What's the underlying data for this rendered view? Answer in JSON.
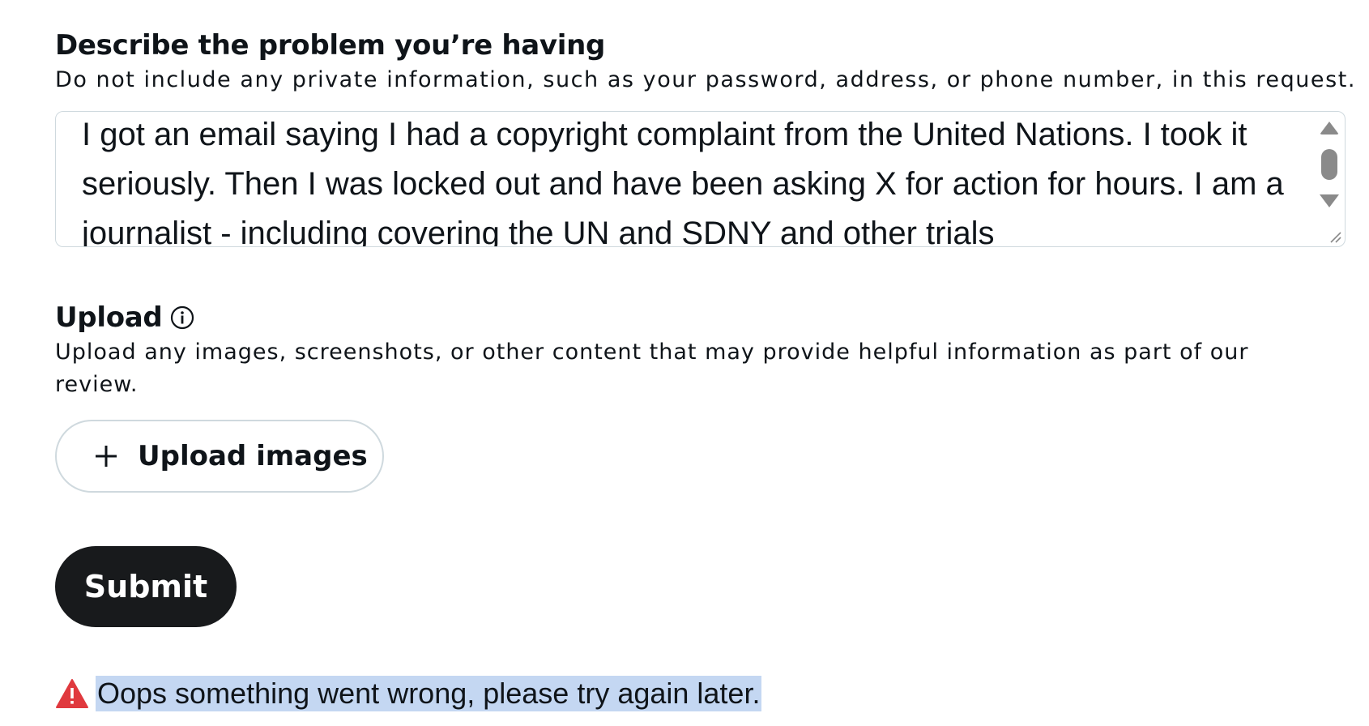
{
  "problem": {
    "title": "Describe the problem you’re having",
    "subtitle": "Do not include any private information, such as your password, address, or phone number, in this request.",
    "textarea_value": "I got an email saying I had a copyright complaint from the United Nations. I took it seriously.  Then I was locked out and have been asking X for action for hours. I am a journalist - including covering the UN and SDNY and other trials"
  },
  "upload": {
    "title": "Upload",
    "info_icon": "info-circle-icon",
    "subtitle": "Upload any images, screenshots, or other content that may provide helpful information as part of our review.",
    "button_label": "Upload images",
    "button_icon": "plus-icon"
  },
  "submit": {
    "label": "Submit"
  },
  "error": {
    "icon": "warning-triangle-icon",
    "icon_color": "#e0393e",
    "message": "Oops something went wrong, please try again later.",
    "highlight_color": "#c4d7f2"
  }
}
